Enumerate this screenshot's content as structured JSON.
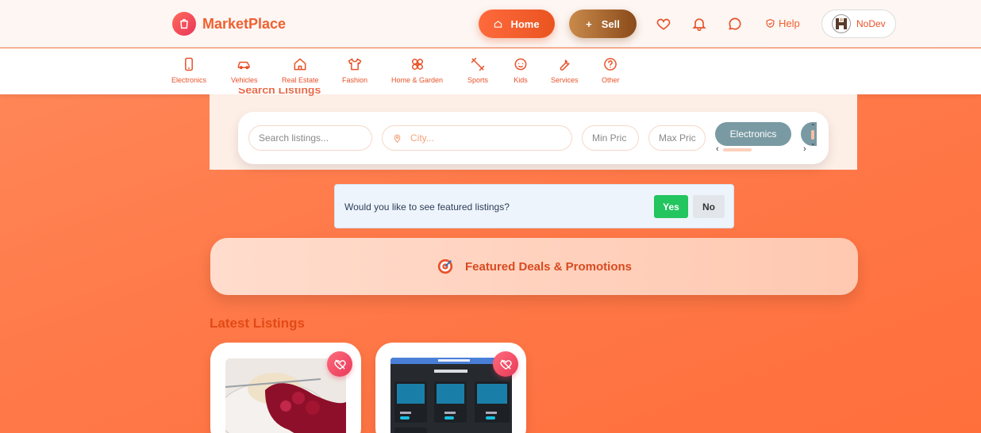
{
  "brand": {
    "name": "MarketPlace"
  },
  "header": {
    "home_label": "Home",
    "sell_label": "Sell",
    "help_label": "Help",
    "user_name": "NoDev"
  },
  "categories": [
    {
      "label": "Electronics",
      "icon": "phone-icon"
    },
    {
      "label": "Vehicles",
      "icon": "car-icon"
    },
    {
      "label": "Real Estate",
      "icon": "house-icon"
    },
    {
      "label": "Fashion",
      "icon": "shirt-icon"
    },
    {
      "label": "Home & Garden",
      "icon": "flower-icon"
    },
    {
      "label": "Sports",
      "icon": "dumbbell-icon"
    },
    {
      "label": "Kids",
      "icon": "baby-icon"
    },
    {
      "label": "Services",
      "icon": "wrench-icon"
    },
    {
      "label": "Other",
      "icon": "question-icon"
    }
  ],
  "search": {
    "title": "Search Listings",
    "query_placeholder": "Search listings...",
    "city_placeholder": "City...",
    "min_price_placeholder": "Min Pric",
    "max_price_placeholder": "Max Pric",
    "active_category": "Electronics"
  },
  "prompt": {
    "text": "Would you like to see featured listings?",
    "yes_label": "Yes",
    "no_label": "No"
  },
  "promo": {
    "title": "Featured Deals & Promotions"
  },
  "latest": {
    "title": "Latest Listings",
    "cards": [
      {
        "image": "dessert-photo"
      },
      {
        "image": "screenshot-latest-listings",
        "inner_title": "Latest Listings"
      }
    ]
  },
  "colors": {
    "accent": "#e8522a",
    "background": "#ff7a4a",
    "yes_button": "#22c55e",
    "chip": "#7a9aa3"
  }
}
